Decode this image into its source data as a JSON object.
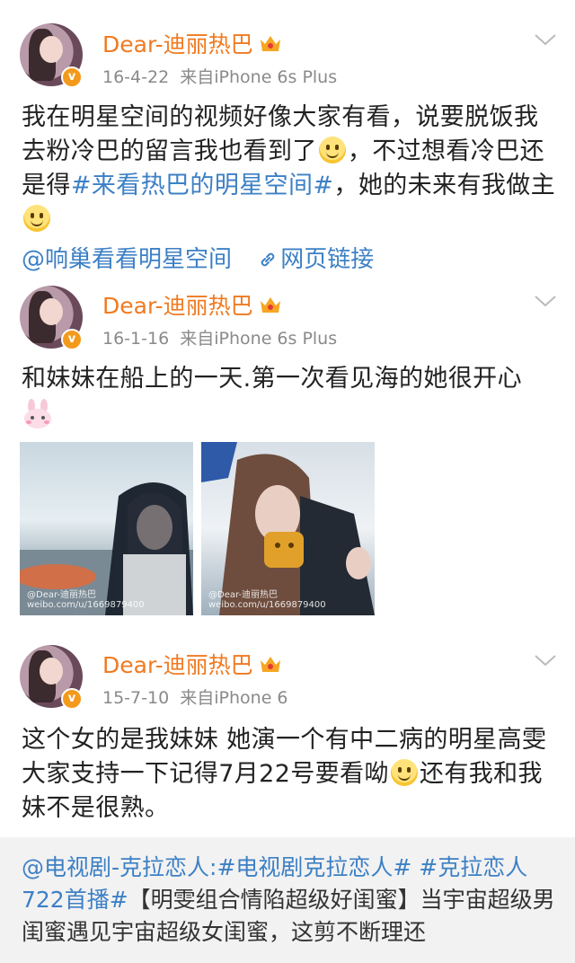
{
  "posts": [
    {
      "author": "Dear-迪丽热巴",
      "date": "16-4-22",
      "source": "来自iPhone 6s Plus",
      "text_parts": [
        "我在明星空间的视频好像大家有看，说要脱饭我去粉冷巴的留言我也看到了",
        "，不过想看冷巴还是得",
        "#来看热巴的明星空间#",
        "，她的未来有我做主"
      ],
      "link_1": "@响巢看看明星空间",
      "link_2": "网页链接"
    },
    {
      "author": "Dear-迪丽热巴",
      "date": "16-1-16",
      "source": "来自iPhone 6s Plus",
      "text": "和妹妹在船上的一天.第一次看见海的她很开心",
      "photo_1_watermark": "@Dear-迪丽热巴 weibo.com/u/1669879400",
      "photo_2_watermark": "@Dear-迪丽热巴 weibo.com/u/1669879400"
    },
    {
      "author": "Dear-迪丽热巴",
      "date": "15-7-10",
      "source": "来自iPhone 6",
      "text_parts": [
        "这个女的是我妹妹 她演一个有中二病的明星高雯 大家支持一下记得7月22号要看呦",
        "还有我和我妹不是很熟。"
      ]
    }
  ],
  "repost": {
    "tag_1": "@电视剧-克拉恋人:#电视剧克拉恋人# #克拉恋人722首播#",
    "body": "【明雯组合情陷超级好闺蜜】当宇宙超级男闺蜜遇见宇宙超级女闺蜜，这剪不断理还"
  },
  "badge": "v",
  "icons": {
    "verified": "verified-badge-icon",
    "crown": "crown-icon",
    "chevron": "chevron-down-icon",
    "link": "link-icon",
    "smile": "smile-emoji-icon",
    "bunny": "bunny-emoji-icon"
  },
  "colors": {
    "name": "#f07a21",
    "link": "#3d80c5",
    "meta": "#8a8a8a",
    "badge": "#f39a1b"
  }
}
